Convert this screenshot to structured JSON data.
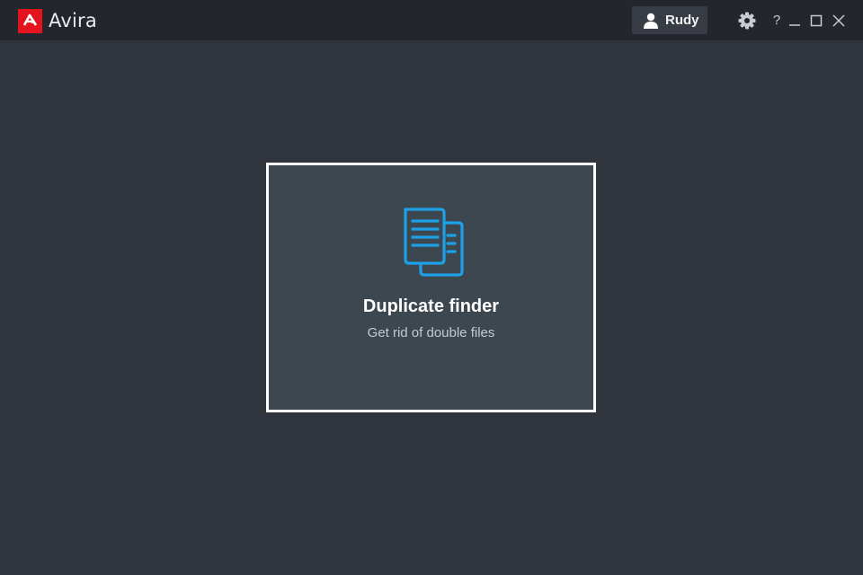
{
  "app": {
    "name": "Avira",
    "logo_icon": "avira-umbrella-icon",
    "brand_color": "#e3141d"
  },
  "titlebar": {
    "user_name": "Rudy",
    "user_icon": "user-icon",
    "settings_icon": "gear-icon",
    "help_label": "?",
    "minimize_icon": "minimize-icon",
    "maximize_icon": "maximize-icon",
    "close_icon": "close-icon"
  },
  "tile": {
    "title": "Duplicate finder",
    "subtitle": "Get rid of double files",
    "icon": "duplicate-documents-icon",
    "icon_color": "#1ea0e6"
  }
}
